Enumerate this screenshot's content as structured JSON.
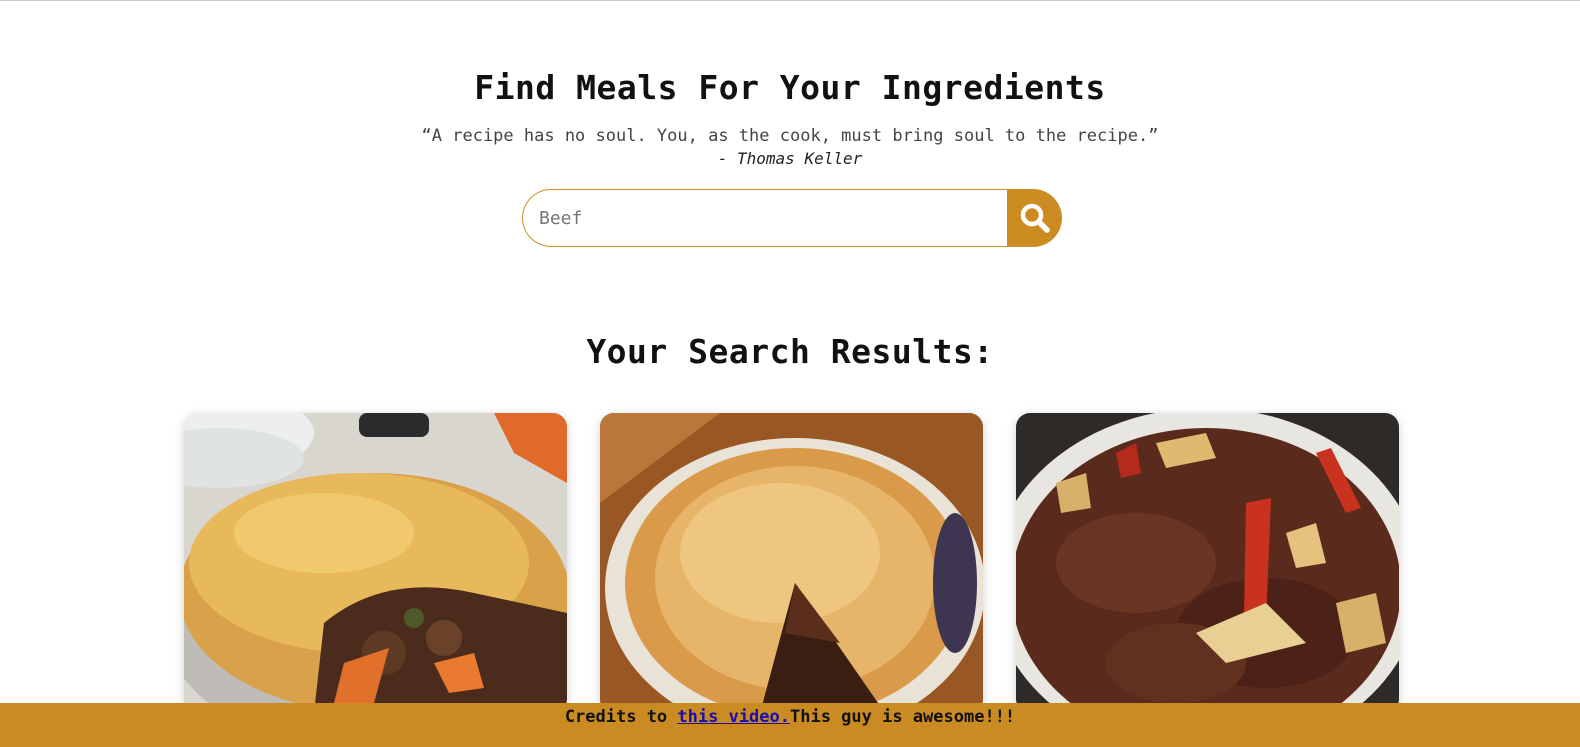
{
  "header": {
    "title": "Find Meals For Your Ingredients",
    "quote": "“A recipe has no soul. You, as the cook, must bring soul to the recipe.”",
    "author": "- Thomas Keller"
  },
  "search": {
    "placeholder": "Beef",
    "value": "",
    "button_icon": "search-icon"
  },
  "results": {
    "heading": "Your Search Results:",
    "cards": [
      {
        "image": "beef-pie-photo"
      },
      {
        "image": "beef-pie-slice-photo"
      },
      {
        "image": "beef-stew-photo"
      }
    ]
  },
  "footer": {
    "prefix": "Credits to ",
    "link_text": "this video.",
    "suffix": "This guy is awesome!!!"
  },
  "colors": {
    "accent": "#cd8c22",
    "footer_bg": "#ca8b22",
    "link": "#1a0dab"
  }
}
